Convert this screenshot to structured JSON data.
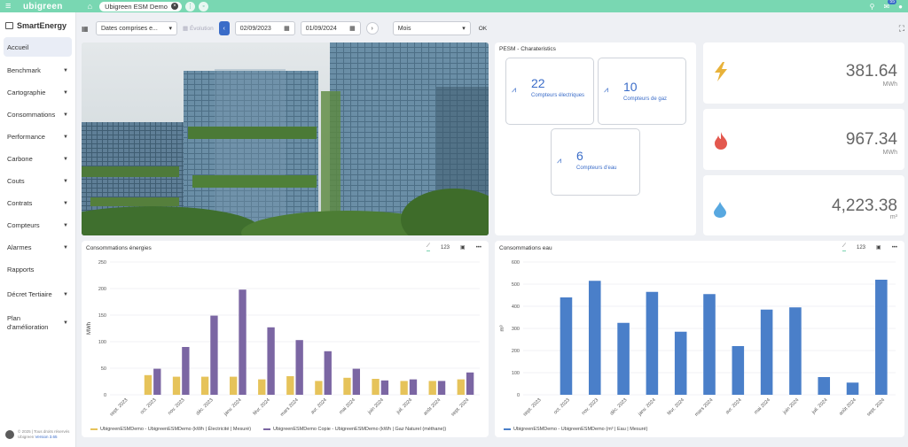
{
  "topbar": {
    "brand": "ubigreen",
    "tab_label": "Ubigreen ESM Demo",
    "notif_count": "55"
  },
  "sidebar": {
    "title": "SmartEnergy",
    "items": [
      {
        "label": "Accueil",
        "caret": false
      },
      {
        "label": "Benchmark",
        "caret": true
      },
      {
        "label": "Cartographie",
        "caret": true
      },
      {
        "label": "Consommations",
        "caret": true
      },
      {
        "label": "Performance",
        "caret": true
      },
      {
        "label": "Carbone",
        "caret": true
      },
      {
        "label": "Couts",
        "caret": true
      },
      {
        "label": "Contrats",
        "caret": true
      },
      {
        "label": "Compteurs",
        "caret": true
      },
      {
        "label": "Alarmes",
        "caret": true
      },
      {
        "label": "Rapports",
        "caret": false
      },
      {
        "label": "Décret Tertiaire",
        "caret": true
      },
      {
        "label": "Plan d'amélioration",
        "caret": true
      }
    ],
    "footer_line1": "© 2025 | Tous droits réservés",
    "footer_line2": "Ubigreen",
    "footer_version": "Version 3.65"
  },
  "filter": {
    "date_mode": "Dates comprises e...",
    "evolution_label": "Évolution",
    "start_date": "02/09/2023",
    "end_date": "01/09/2024",
    "granularity": "Mois",
    "ok_label": "OK"
  },
  "pesm": {
    "title": "PESM - Charateristics",
    "counters": [
      {
        "count": "22",
        "label": "Compteurs électriques"
      },
      {
        "count": "10",
        "label": "Compteurs de gaz"
      },
      {
        "count": "6",
        "label": "Compteurs d'eau"
      }
    ]
  },
  "kpis": [
    {
      "value": "381.64",
      "unit": "MWh",
      "icon": "lightning-icon",
      "color": "#e8b23a"
    },
    {
      "value": "967.34",
      "unit": "MWh",
      "icon": "flame-icon",
      "color": "#e3584e"
    },
    {
      "value": "4,223.38",
      "unit": "m³",
      "icon": "water-drop-icon",
      "color": "#58a8e0"
    }
  ],
  "colors": {
    "accent": "#3a6cc8",
    "brand": "#79d7b2",
    "elec": "#e6c35a",
    "gas": "#7b66a3",
    "water": "#4a7fc9"
  },
  "chart_data": [
    {
      "type": "bar",
      "title": "Consommations énergies",
      "ylabel": "MWh",
      "ylim": [
        0,
        250
      ],
      "yticks": [
        0,
        50,
        100,
        150,
        200,
        250
      ],
      "categories": [
        "sept. 2023",
        "oct. 2023",
        "nov. 2023",
        "déc. 2023",
        "janv. 2024",
        "févr. 2024",
        "mars 2024",
        "avr. 2024",
        "mai 2024",
        "juin 2024",
        "juil. 2024",
        "août 2024",
        "sept. 2024"
      ],
      "series": [
        {
          "name": "UbigreenESMDemo - UbigreenESMDemo (kWh | Électricité | Mesuré)",
          "color": "#e6c35a",
          "values": [
            0,
            37,
            34,
            34,
            34,
            29,
            35,
            26,
            32,
            30,
            26,
            26,
            29
          ]
        },
        {
          "name": "UbigreenESMDemo Copie - UbigreenESMDemo (kWh | Gaz Naturel (méthane))",
          "color": "#7b66a3",
          "values": [
            0,
            49,
            90,
            149,
            198,
            127,
            103,
            82,
            49,
            27,
            29,
            26,
            42
          ]
        }
      ],
      "grid": true,
      "legend": "bottom"
    },
    {
      "type": "bar",
      "title": "Consommations eau",
      "ylabel": "m³",
      "ylim": [
        0,
        600
      ],
      "yticks": [
        0,
        100,
        200,
        300,
        400,
        500,
        600
      ],
      "categories": [
        "sept. 2023",
        "oct. 2023",
        "nov. 2023",
        "déc. 2023",
        "janv. 2024",
        "févr. 2024",
        "mars 2024",
        "avr. 2024",
        "mai 2024",
        "juin 2024",
        "juil. 2024",
        "août 2024",
        "sept. 2024"
      ],
      "series": [
        {
          "name": "UbigreenESMDemo - UbigreenESMDemo (m³ | Eau | Mesuré)",
          "color": "#4a7fc9",
          "values": [
            0,
            440,
            515,
            325,
            465,
            285,
            455,
            220,
            385,
            395,
            80,
            55,
            520
          ]
        }
      ],
      "grid": true,
      "legend": "bottom"
    }
  ]
}
